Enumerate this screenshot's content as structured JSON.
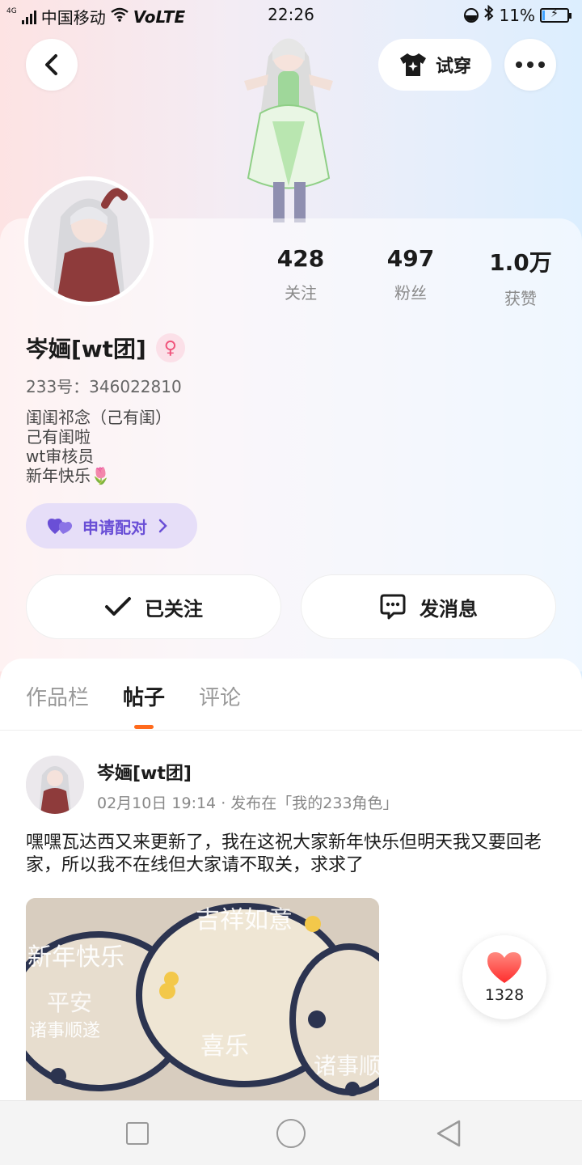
{
  "status_bar": {
    "network": "4G",
    "carrier": "中国移动",
    "volte": "VoLTE",
    "time": "22:26",
    "battery_percent": "11%",
    "battery_level": 0.11,
    "icons": [
      "signal-icon",
      "wifi-icon",
      "dnd-icon",
      "bluetooth-icon",
      "battery-icon"
    ]
  },
  "header": {
    "back_icon": "chevron-left-icon",
    "tryon_label": "试穿",
    "tryon_icon": "tshirt-icon",
    "more_icon": "more-dots-icon"
  },
  "profile": {
    "stats": [
      {
        "value": "428",
        "label": "关注"
      },
      {
        "value": "497",
        "label": "粉丝"
      },
      {
        "value": "1.0万",
        "label": "获赞"
      }
    ],
    "username": "岑婳[wt团]",
    "gender_icon": "female-icon",
    "uid": "233号：346022810",
    "bio_lines": [
      "闺闺祁念（己有闺）",
      "己有闺啦",
      "wt审核员",
      "新年快乐🌷"
    ],
    "pair_label": "申请配对",
    "follow_label": "已关注",
    "message_label": "发消息"
  },
  "tabs": [
    {
      "label": "作品栏",
      "active": false
    },
    {
      "label": "帖子",
      "active": true
    },
    {
      "label": "评论",
      "active": false
    }
  ],
  "post": {
    "author": "岑婳[wt团]",
    "meta": "02月10日 19:14 · 发布在「我的233角色」",
    "text": "嘿嘿瓦达西又来更新了，我在这祝大家新年快乐但明天我又要回老家，所以我不在线但大家请不取关，求求了",
    "image_texts": [
      "新年快乐",
      "平安",
      "诸事顺遂",
      "喜乐",
      "吉祥如意"
    ],
    "like_count": "1328",
    "like_icon": "heart-icon"
  },
  "colors": {
    "accent_orange": "#ff6a1c",
    "pair_purple": "#6a4fd6",
    "gender_pink": "#f0527a",
    "heart_red": "#ff3b3b"
  }
}
